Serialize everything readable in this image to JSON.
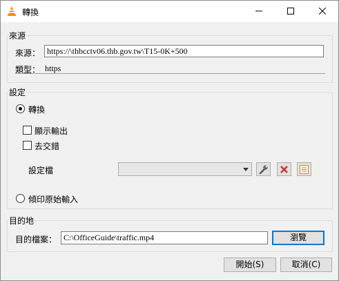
{
  "window": {
    "title": "轉換"
  },
  "source": {
    "group_label": "來源",
    "source_label": "來源：",
    "source_value": "https://\\thbcctv06.thb.gov.tw\\T15-0K+500",
    "type_label": "類型：",
    "type_value": "https"
  },
  "settings": {
    "group_label": "設定",
    "convert_label": "轉換",
    "show_output_label": "顯示輸出",
    "deinterlace_label": "去交錯",
    "profile_label": "設定檔",
    "profile_value": "",
    "dump_raw_label": "傾印原始輸入"
  },
  "destination": {
    "group_label": "目的地",
    "file_label": "目的檔案：",
    "file_value": "C:\\OfficeGuide\\traffic.mp4",
    "browse_label": "瀏覽"
  },
  "footer": {
    "start_label": "開始(S)",
    "cancel_label": "取消(C)"
  },
  "icons": {
    "app": "vlc-cone-icon",
    "edit_profile": "wrench-icon",
    "delete_profile": "red-x-icon",
    "new_profile": "list-icon"
  },
  "colors": {
    "accent": "#0078d7",
    "delete_red": "#d32f2f",
    "vlc_orange": "#ff8800"
  }
}
